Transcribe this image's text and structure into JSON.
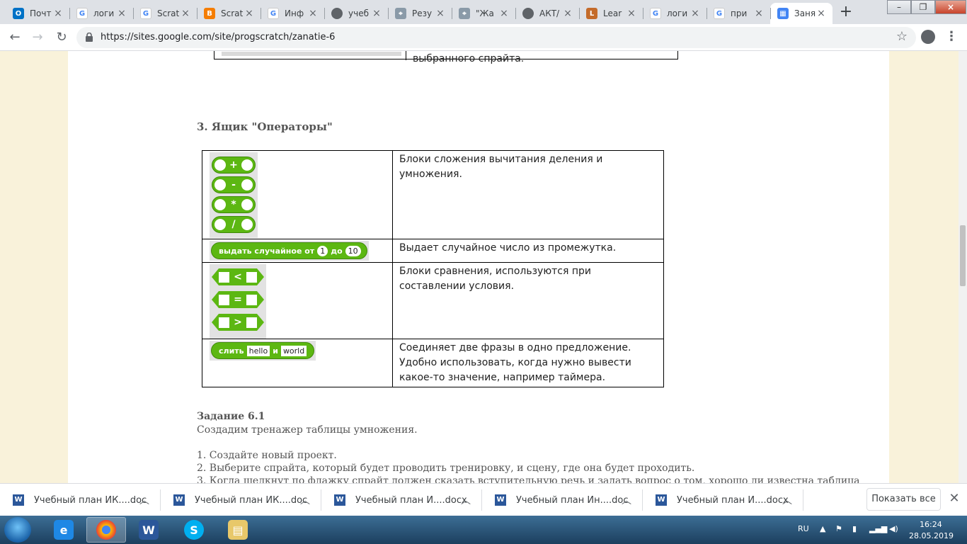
{
  "browser": {
    "tabs": [
      {
        "label": "Почт",
        "icon": "outlook-icon",
        "color": "#0072c6",
        "glyph": "O"
      },
      {
        "label": "логи",
        "icon": "google-icon",
        "color": "#4285f4",
        "glyph": "G"
      },
      {
        "label": "Scrat",
        "icon": "google-icon",
        "color": "#4285f4",
        "glyph": "G"
      },
      {
        "label": "Scrat",
        "icon": "blogger-icon",
        "color": "#f57d00",
        "glyph": "B"
      },
      {
        "label": "Инф",
        "icon": "google-icon",
        "color": "#4285f4",
        "glyph": "G"
      },
      {
        "label": "учеб",
        "icon": "globe-icon",
        "color": "#5f6368",
        "glyph": "◉"
      },
      {
        "label": "Резу",
        "icon": "site-icon",
        "color": "#8a9aa8",
        "glyph": "⌖"
      },
      {
        "label": "\"Жа",
        "icon": "site-icon",
        "color": "#8a9aa8",
        "glyph": "⌖"
      },
      {
        "label": "АКТ/",
        "icon": "globe-icon",
        "color": "#5f6368",
        "glyph": "◉"
      },
      {
        "label": "Lear",
        "icon": "learn-icon",
        "color": "#c46b2a",
        "glyph": "L"
      },
      {
        "label": "логи",
        "icon": "google-icon",
        "color": "#4285f4",
        "glyph": "G"
      },
      {
        "label": "при",
        "icon": "google-icon",
        "color": "#4285f4",
        "glyph": "G"
      },
      {
        "label": "Заня",
        "icon": "google-sites-icon",
        "color": "#4285f4",
        "glyph": "▦"
      }
    ],
    "new_tab": "+",
    "url_host": "https://sites.google.com",
    "url_path": "/site/progscratch/zanatie-6"
  },
  "page": {
    "prev_cell_text": "выбранного спрайта.",
    "heading": "3. Ящик \"Операторы\"",
    "rows": [
      {
        "desc": "Блоки сложения вычитания деления и умножения."
      },
      {
        "desc": "Выдает случайное число из промежутка."
      },
      {
        "desc": "Блоки сравнения, используются при составлении условия."
      },
      {
        "desc": "Соединяет две фразы в одно предложение. Удобно использовать, когда нужно вывести какое-то значение, например таймера."
      }
    ],
    "operator_symbols": [
      "+",
      "-",
      "*",
      "/"
    ],
    "random_block": {
      "prefix": "выдать случайное от",
      "from": "1",
      "mid": "до",
      "to": "10"
    },
    "compare_symbols": [
      "<",
      "=",
      ">"
    ],
    "join_block": {
      "label": "слить",
      "a": "hello",
      "mid": "и",
      "b": "world"
    },
    "task_title": "Задание 6.1",
    "task_intro": "Создадим тренажер таблицы умножения.",
    "steps": [
      "1. Создайте новый проект.",
      "2. Выберите спрайта, который будет проводить тренировку, и сцену, где она будет проходить.",
      "3. Когда щелкнут по флажку спрайт должен сказать вступительную речь и задать вопрос о том, хорошо ли известна таблица"
    ]
  },
  "downloads": {
    "items": [
      "Учебный план ИК....doc",
      "Учебный план ИК....doc",
      "Учебный план И....docx",
      "Учебный план Ин....doc",
      "Учебный план И....docx"
    ],
    "show_all": "Показать все"
  },
  "taskbar": {
    "lang": "RU",
    "time": "16:24",
    "date": "28.05.2019"
  },
  "colors": {
    "scratch_operator_green": "#5cb712",
    "page_bg": "#f9f2da"
  }
}
